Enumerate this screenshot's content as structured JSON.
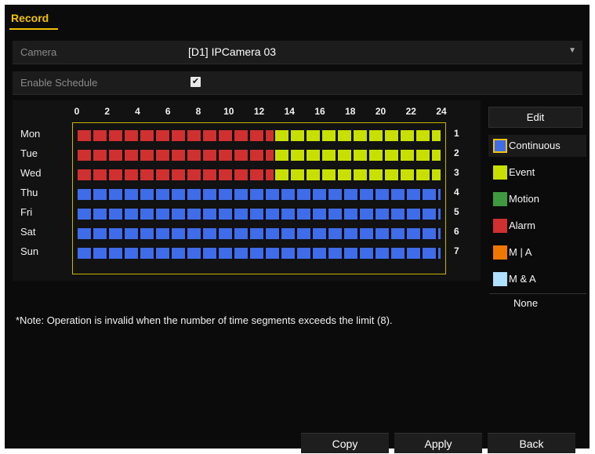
{
  "header": {
    "tab_label": "Record"
  },
  "fields": {
    "camera_label": "Camera",
    "camera_value": "[D1] IPCamera 03",
    "enable_label": "Enable Schedule",
    "enable_checked": "✔"
  },
  "schedule": {
    "hours": [
      "0",
      "2",
      "4",
      "6",
      "8",
      "10",
      "12",
      "14",
      "16",
      "18",
      "20",
      "22",
      "24"
    ],
    "days": [
      {
        "label": "Mon",
        "number": "1",
        "segments": [
          {
            "from": 0,
            "to": 13,
            "type": "Alarm"
          },
          {
            "from": 13,
            "to": 24,
            "type": "Event"
          }
        ]
      },
      {
        "label": "Tue",
        "number": "2",
        "segments": [
          {
            "from": 0,
            "to": 13,
            "type": "Alarm"
          },
          {
            "from": 13,
            "to": 24,
            "type": "Event"
          }
        ]
      },
      {
        "label": "Wed",
        "number": "3",
        "segments": [
          {
            "from": 0,
            "to": 13,
            "type": "Alarm"
          },
          {
            "from": 13,
            "to": 24,
            "type": "Event"
          }
        ]
      },
      {
        "label": "Thu",
        "number": "4",
        "segments": [
          {
            "from": 0,
            "to": 24,
            "type": "Continuous"
          }
        ]
      },
      {
        "label": "Fri",
        "number": "5",
        "segments": [
          {
            "from": 0,
            "to": 24,
            "type": "Continuous"
          }
        ]
      },
      {
        "label": "Sat",
        "number": "6",
        "segments": [
          {
            "from": 0,
            "to": 24,
            "type": "Continuous"
          }
        ]
      },
      {
        "label": "Sun",
        "number": "7",
        "segments": [
          {
            "from": 0,
            "to": 24,
            "type": "Continuous"
          }
        ]
      }
    ]
  },
  "sidebar": {
    "edit_label": "Edit",
    "legend": [
      {
        "label": "Continuous",
        "color": "#3f6ce8",
        "selected": true
      },
      {
        "label": "Event",
        "color": "#c8e000"
      },
      {
        "label": "Motion",
        "color": "#3f9a3f"
      },
      {
        "label": "Alarm",
        "color": "#d03030"
      },
      {
        "label": "M | A",
        "color": "#f07800"
      },
      {
        "label": "M & A",
        "color": "#aee0ff"
      }
    ],
    "none_label": "None"
  },
  "note": "*Note: Operation is invalid when the number of time segments exceeds the limit (8).",
  "footer": {
    "copy_label": "Copy",
    "apply_label": "Apply",
    "back_label": "Back"
  }
}
